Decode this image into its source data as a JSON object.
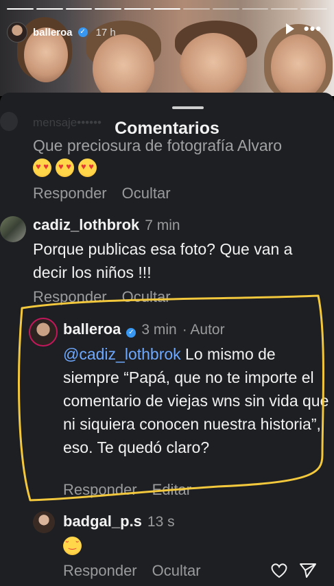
{
  "story": {
    "username": "balleroa",
    "time": "17 h",
    "progress_segments": 11,
    "progress_done": 6,
    "icons": {
      "play": "play-icon",
      "more": "more-icon",
      "verified": "verified-icon"
    }
  },
  "sheet": {
    "title": "Comentarios",
    "faded_user": "mensaje••••••",
    "comments": [
      {
        "id": "top",
        "text": "Que preciosura de fotografía Alvaro",
        "emojis": [
          "heart-eyes",
          "heart-eyes",
          "heart-eyes"
        ],
        "reply_label": "Responder",
        "hide_label": "Ocultar"
      },
      {
        "id": "cadiz",
        "username": "cadiz_lothbrok",
        "time": "7 min",
        "text": "Porque publicas esa foto? Que van a decir los niños !!!",
        "reply_label": "Responder",
        "hide_label": "Ocultar"
      },
      {
        "id": "balleroa",
        "username": "balleroa",
        "time": "3 min",
        "author_label": "· Autor",
        "mention": "@cadiz_lothbrok",
        "text": " Lo mismo de siempre “Papá, que no te importe el comentario de viejas wns sin vida que ni siquiera conocen nuestra historia”, eso. Te quedó claro?",
        "reply_label": "Responder",
        "edit_label": "Editar"
      },
      {
        "id": "badgal",
        "username": "badgal_p.s",
        "time": "13 s",
        "emoji": "laughing-with-tears",
        "reply_label": "Responder",
        "hide_label": "Ocultar"
      }
    ]
  },
  "colors": {
    "highlight": "#f3c83c",
    "verified": "#3897f0",
    "mention": "#6ea9ff",
    "sheet_bg": "#1d1f22"
  },
  "bottom_icons": [
    "heart-icon",
    "send-icon"
  ]
}
